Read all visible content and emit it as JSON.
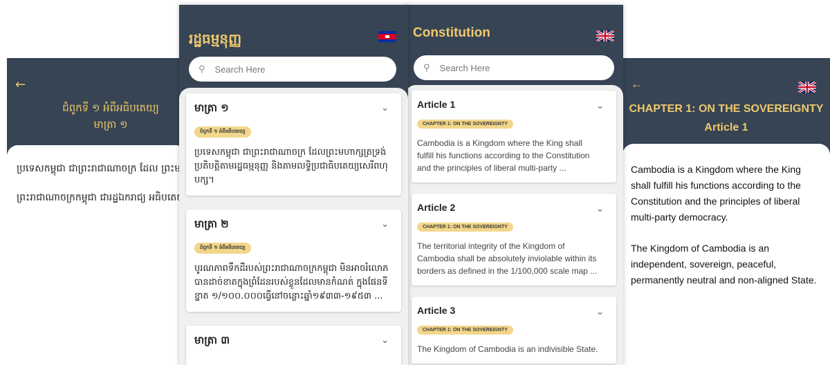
{
  "khmer_detail": {
    "chapter_title": "ជំពូកទី ១ អំពីអធិបតេយ្យ",
    "article_title": "មាត្រា ១",
    "paragraphs": [
      "ប្រទេសកម្ពុជា ជាព្រះរាជាណាចក្រ ដែល ព្រះមហាក្សត្រទ្រង់ប្រតិបត្តិតាមរដ្ឋធម្មនុញ្ញ និង តាមលទ្ធិប្រជាធិបតេយ្យសេរីពហុបក្ស។",
      "ព្រះរាជាណាចក្រកម្ពុជា ជារដ្ឋឯករាជ្យ អធិបតេយ្យ សន្តិភាព អព្យាក្រឹត អចិន្ត្រៃយ៍ មិន ចូលបក្សសម្ព័ន្ធ។"
    ]
  },
  "khmer_list": {
    "app_title": "រដ្ឋធម្មនុញ្ញ",
    "search_placeholder": "Search Here",
    "cards": [
      {
        "title": "មាត្រា ១",
        "tag": "ជំពូកទី ១ អំពីអធិបតេយ្យ",
        "lines": [
          "ប្រទេសកម្ពុជា ជាព្រះរាជាណាចក្រ ដែលព្រះមហាក្សត្រទ្រង់",
          "ប្រតិបត្តិតាមរដ្ឋធម្មនុញ្ញ និងតាមលទ្ធិប្រជាធិបតេយ្យសេរីពហុ",
          "បក្ស។"
        ]
      },
      {
        "title": "មាត្រា ២",
        "tag": "ជំពូកទី ១ អំពីអធិបតេយ្យ",
        "lines": [
          "បូរណភាពទឹកដីរបស់ព្រះរាជាណាចក្រកម្ពុជា មិនអាចរំលោភ",
          "បានដាច់ខាតក្នុងព្រំដែនរបស់ខ្លួនដែលមានកំណត់ ក្នុងផែនទី",
          "ខ្នាត ១/១០០.០០០ធ្វើនៅចន្លោះឆ្នាំ១៩៣៣-១៩៥៣ ..."
        ]
      },
      {
        "title": "មាត្រា ៣",
        "tag": "",
        "lines": []
      }
    ]
  },
  "english_list": {
    "app_title": "Constitution",
    "search_placeholder": "Search Here",
    "cards": [
      {
        "title": "Article 1",
        "tag": "CHAPTER 1: ON THE SOVEREIGNTY",
        "lines": [
          "Cambodia is a Kingdom where the King shall",
          "fulfill his functions according to the Constitution",
          "and the principles of liberal multi-party ..."
        ]
      },
      {
        "title": "Article 2",
        "tag": "CHAPTER 1: ON THE SOVEREIGNTY",
        "lines": [
          "The territorial integrity of the Kingdom of",
          "Cambodia shall be absolutely inviolable within its",
          "borders as defined in the 1/100,000 scale map ..."
        ]
      },
      {
        "title": "Article 3",
        "tag": "CHAPTER 1: ON THE SOVEREIGNTY",
        "lines": [
          "The Kingdom of Cambodia is an indivisible State."
        ]
      }
    ]
  },
  "english_detail": {
    "chapter_title": "CHAPTER 1: ON THE SOVEREIGNTY",
    "article_title": "Article 1",
    "paragraphs": [
      "Cambodia is a Kingdom where the King shall fulfill his functions according to the Constitution and the principles of liberal multi-party democracy.",
      "The Kingdom of Cambodia is an independent, sovereign, peaceful, permanently neutral and non-aligned State."
    ]
  },
  "icons": {
    "back": "arrow-left-icon",
    "search": "magnifier-icon",
    "expand": "chevron-down-icon",
    "flag_khmer": "cambodia-flag-icon",
    "flag_english": "uk-flag-icon"
  },
  "colors": {
    "header_bg": "#364454",
    "accent_gold": "#f0c86c",
    "tag_bg": "#f2d68a"
  }
}
